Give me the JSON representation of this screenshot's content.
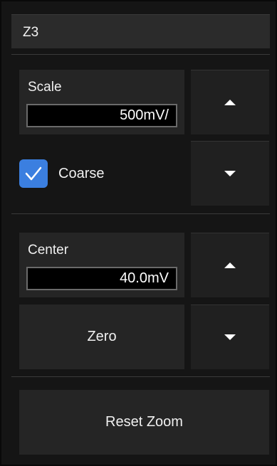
{
  "panel": {
    "title": "Z3"
  },
  "scale": {
    "label": "Scale",
    "value": "500mV/"
  },
  "coarse": {
    "label": "Coarse",
    "checked": true
  },
  "center": {
    "label": "Center",
    "value": "40.0mV"
  },
  "buttons": {
    "zero": "Zero",
    "reset_zoom": "Reset Zoom"
  },
  "icons": {
    "up": "triangle-up-icon",
    "down": "triangle-down-icon",
    "check": "checkmark-icon"
  },
  "colors": {
    "accent": "#3b7fe0",
    "panel_bg": "#151515",
    "control_bg": "#252525"
  }
}
